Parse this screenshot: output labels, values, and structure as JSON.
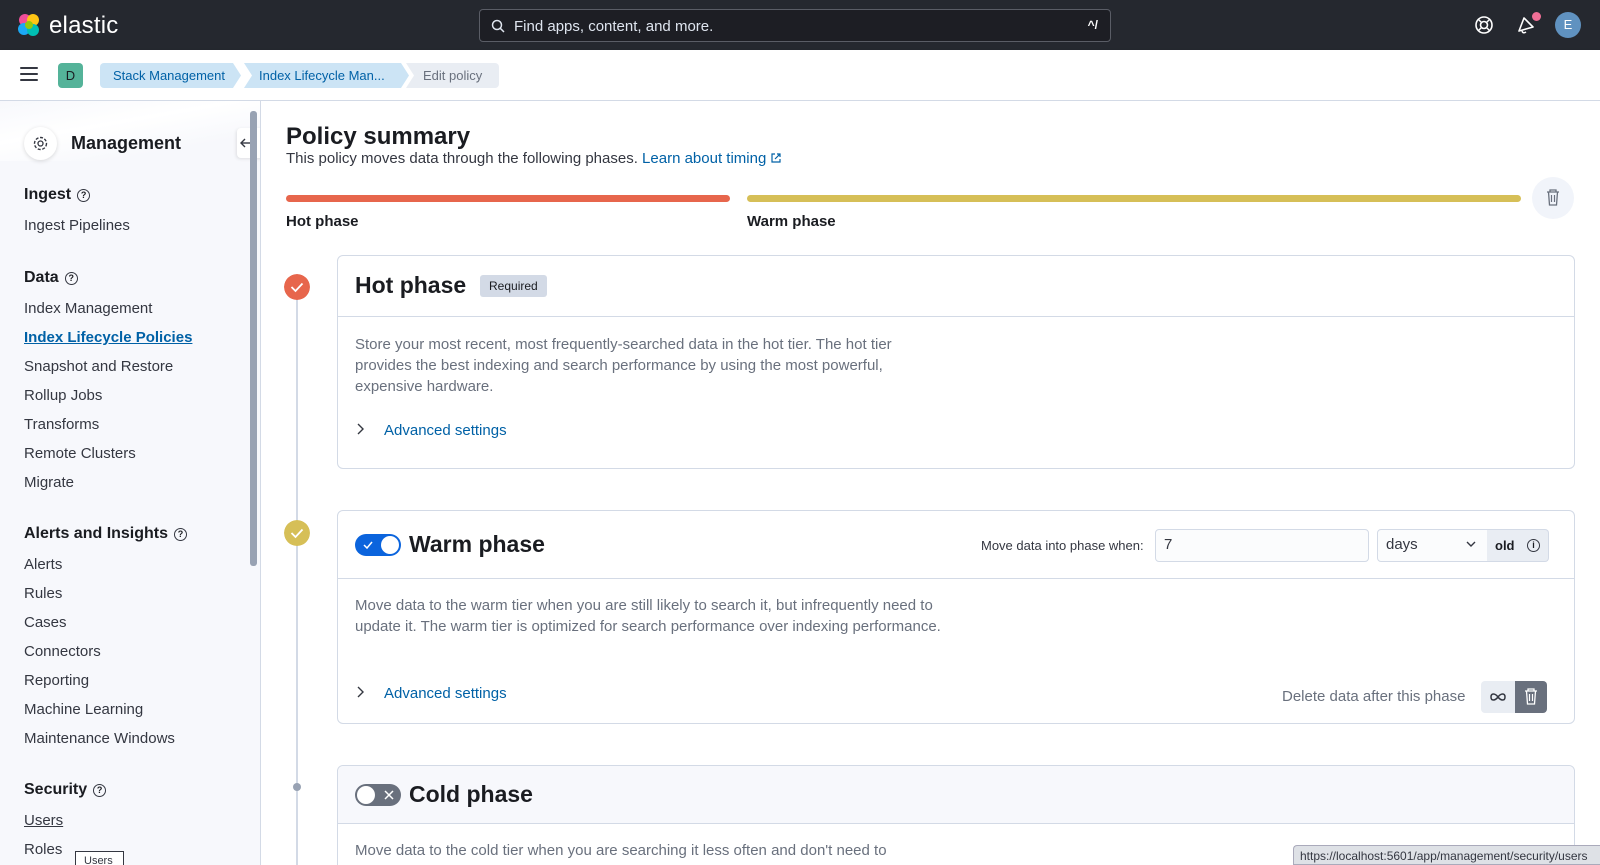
{
  "topbar": {
    "brand": "elastic",
    "search_placeholder": "Find apps, content, and more.",
    "search_shortcut": "^/",
    "avatar_initial": "E"
  },
  "subbar": {
    "space_initial": "D",
    "breadcrumbs": [
      "Stack Management",
      "Index Lifecycle Man...",
      "Edit policy"
    ]
  },
  "sidebar": {
    "title": "Management",
    "sections": [
      {
        "label": "Ingest",
        "items": [
          "Ingest Pipelines"
        ]
      },
      {
        "label": "Data",
        "items": [
          "Index Management",
          "Index Lifecycle Policies",
          "Snapshot and Restore",
          "Rollup Jobs",
          "Transforms",
          "Remote Clusters",
          "Migrate"
        ]
      },
      {
        "label": "Alerts and Insights",
        "items": [
          "Alerts",
          "Rules",
          "Cases",
          "Connectors",
          "Reporting",
          "Machine Learning",
          "Maintenance Windows"
        ]
      },
      {
        "label": "Security",
        "items": [
          "Users",
          "Roles"
        ]
      }
    ],
    "active_item": "Index Lifecycle Policies",
    "tooltip": "Users"
  },
  "main": {
    "title": "Policy summary",
    "lede": "This policy moves data through the following phases.",
    "lede_link": "Learn about timing",
    "summary_labels": [
      "Hot phase",
      "Warm phase"
    ],
    "colors": {
      "hot": "#e7664c",
      "warm": "#d6bf57",
      "link": "#0061a6",
      "toggle_on": "#0b64dd"
    },
    "hot": {
      "title": "Hot phase",
      "badge": "Required",
      "description": "Store your most recent, most frequently-searched data in the hot tier. The hot tier provides the best indexing and search performance by using the most powerful, expensive hardware.",
      "advanced": "Advanced settings"
    },
    "warm": {
      "title": "Warm phase",
      "enabled": true,
      "move_label": "Move data into phase when:",
      "min_age_value": "7",
      "min_age_unit": "days",
      "min_age_append": "old",
      "description": "Move data to the warm tier when you are still likely to search it, but infrequently need to update it. The warm tier is optimized for search performance over indexing performance.",
      "advanced": "Advanced settings",
      "delete_label": "Delete data after this phase"
    },
    "cold": {
      "title": "Cold phase",
      "enabled": false,
      "description": "Move data to the cold tier when you are searching it less often and don't need to"
    }
  },
  "status_url": "https://localhost:5601/app/management/security/users"
}
